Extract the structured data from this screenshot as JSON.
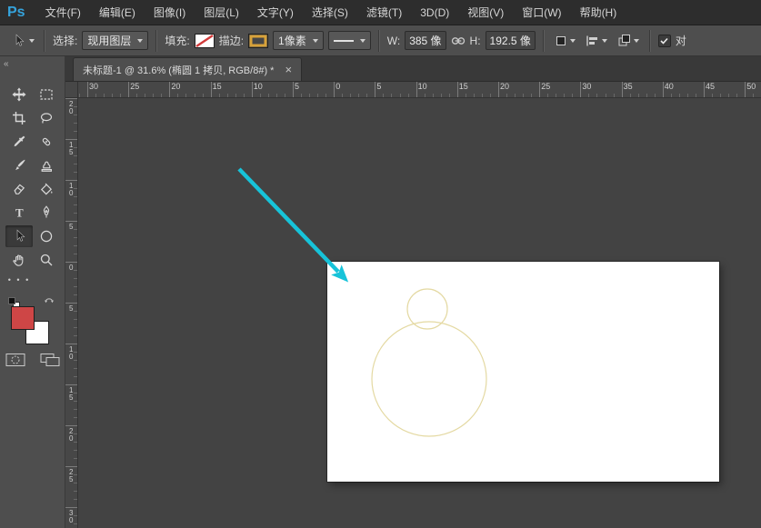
{
  "menu": {
    "logo": "Ps",
    "items": [
      "文件(F)",
      "编辑(E)",
      "图像(I)",
      "图层(L)",
      "文字(Y)",
      "选择(S)",
      "滤镜(T)",
      "3D(D)",
      "视图(V)",
      "窗口(W)",
      "帮助(H)"
    ]
  },
  "options": {
    "select_label": "选择:",
    "select_value": "现用图层",
    "fill_label": "填充:",
    "stroke_label": "描边:",
    "stroke_width_value": "1像素",
    "w_label": "W:",
    "w_value": "385 像",
    "h_label": "H:",
    "h_value": "192.5 像",
    "align_edges_label": "对"
  },
  "tab": {
    "title": "未标题-1 @ 31.6% (椭圆 1 拷贝, RGB/8#) *",
    "close_glyph": "×"
  },
  "toolbar": {
    "collapse_glyph": "«",
    "more_glyph": "• • •",
    "type_glyph": "T",
    "tools": [
      "move",
      "rectangular-marquee",
      "crop",
      "lasso",
      "eyedropper",
      "spot-healing",
      "brush",
      "clone-stamp",
      "eraser",
      "paint-bucket",
      "type",
      "pen",
      "path-selection",
      "ellipse-shape",
      "hand",
      "zoom"
    ]
  },
  "rulers": {
    "horizontal": [
      "30",
      "25",
      "20",
      "15",
      "10",
      "5",
      "0",
      "5",
      "10",
      "15",
      "20",
      "25",
      "30",
      "35",
      "40",
      "45",
      "50"
    ],
    "vertical": [
      "20",
      "15",
      "10",
      "5",
      "0",
      "5",
      "10",
      "15",
      "20",
      "25",
      "30"
    ]
  },
  "colors": {
    "ps_logo_blue": "#35a3dc",
    "arrow_accent": "#17c3d9",
    "shape_stroke": "#e4d9a2",
    "foreground_swatch": "#ce4646",
    "background_swatch": "#ffffff",
    "stroke_swatch_border": "#d8a23a",
    "fill_none_slash": "#d23b3b"
  }
}
